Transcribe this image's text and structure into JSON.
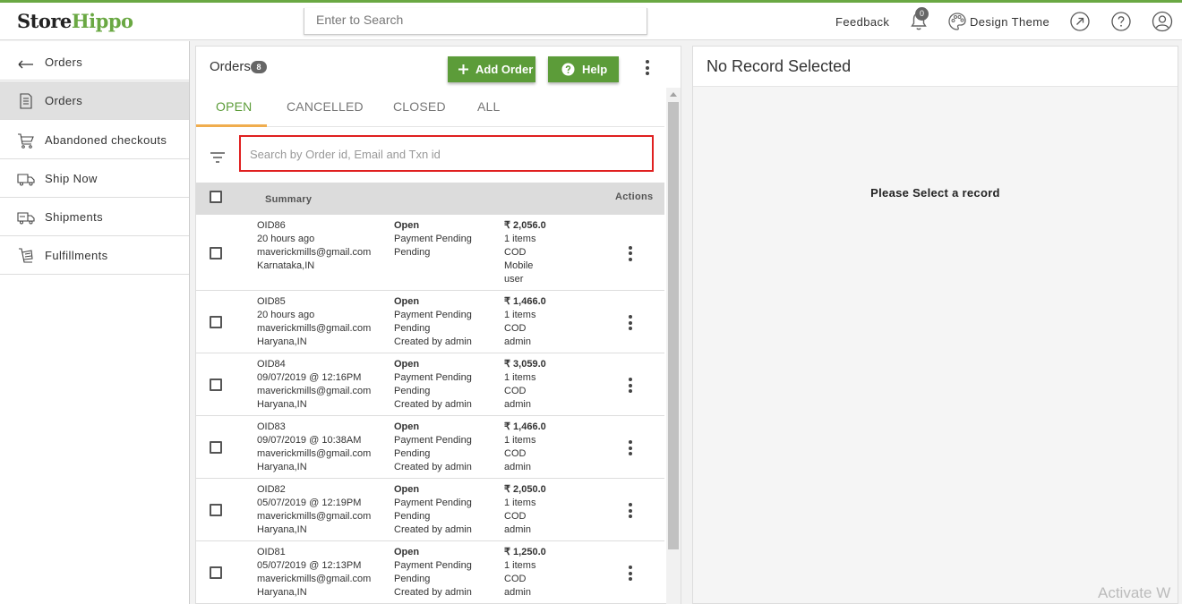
{
  "app": {
    "logo_part1": "Store",
    "logo_part2": "Hippo",
    "search_placeholder": "Enter to Search",
    "feedback": "Feedback",
    "notifications_count": "0",
    "design_theme": "Design Theme",
    "accent_color": "#5c9c39"
  },
  "sidebar": {
    "back_label": "Orders",
    "items": [
      {
        "label": "Orders",
        "icon": "document-icon"
      },
      {
        "label": "Abandoned checkouts",
        "icon": "cart-icon"
      },
      {
        "label": "Ship Now",
        "icon": "truck-icon"
      },
      {
        "label": "Shipments",
        "icon": "shipment-icon"
      },
      {
        "label": "Fulfillments",
        "icon": "fulfillment-icon"
      }
    ]
  },
  "orders": {
    "title": "Orders",
    "count": "8",
    "add_order": "Add Order",
    "help": "Help",
    "tabs": [
      "OPEN",
      "CANCELLED",
      "CLOSED",
      "ALL"
    ],
    "search_placeholder": "Search by Order id, Email and Txn id",
    "col_summary": "Summary",
    "col_actions": "Actions",
    "rows": [
      {
        "info": [
          "OID86",
          "20 hours ago",
          "maverickmills@gmail.com",
          "Karnataka,IN"
        ],
        "status": [
          "Open",
          "Payment Pending",
          "Pending"
        ],
        "amount": [
          "₹ 2,056.0",
          "1 items",
          "COD",
          "Mobile",
          "user"
        ]
      },
      {
        "info": [
          "OID85",
          "20 hours ago",
          "maverickmills@gmail.com",
          "Haryana,IN"
        ],
        "status": [
          "Open",
          "Payment Pending",
          "Pending",
          "Created by admin"
        ],
        "amount": [
          "₹ 1,466.0",
          "1 items",
          "COD",
          "admin"
        ]
      },
      {
        "info": [
          "OID84",
          "09/07/2019 @ 12:16PM",
          "maverickmills@gmail.com",
          "Haryana,IN"
        ],
        "status": [
          "Open",
          "Payment Pending",
          "Pending",
          "Created by admin"
        ],
        "amount": [
          "₹ 3,059.0",
          "1 items",
          "COD",
          "admin"
        ]
      },
      {
        "info": [
          "OID83",
          "09/07/2019 @ 10:38AM",
          "maverickmills@gmail.com",
          "Haryana,IN"
        ],
        "status": [
          "Open",
          "Payment Pending",
          "Pending",
          "Created by admin"
        ],
        "amount": [
          "₹ 1,466.0",
          "1 items",
          "COD",
          "admin"
        ]
      },
      {
        "info": [
          "OID82",
          "05/07/2019 @ 12:19PM",
          "maverickmills@gmail.com",
          "Haryana,IN"
        ],
        "status": [
          "Open",
          "Payment Pending",
          "Pending",
          "Created by admin"
        ],
        "amount": [
          "₹ 2,050.0",
          "1 items",
          "COD",
          "admin"
        ]
      },
      {
        "info": [
          "OID81",
          "05/07/2019 @ 12:13PM",
          "maverickmills@gmail.com",
          "Haryana,IN"
        ],
        "status": [
          "Open",
          "Payment Pending",
          "Pending",
          "Created by admin"
        ],
        "amount": [
          "₹ 1,250.0",
          "1 items",
          "COD",
          "admin"
        ]
      }
    ]
  },
  "detail": {
    "title": "No Record Selected",
    "message": "Please Select a record"
  },
  "watermark": "Activate W"
}
